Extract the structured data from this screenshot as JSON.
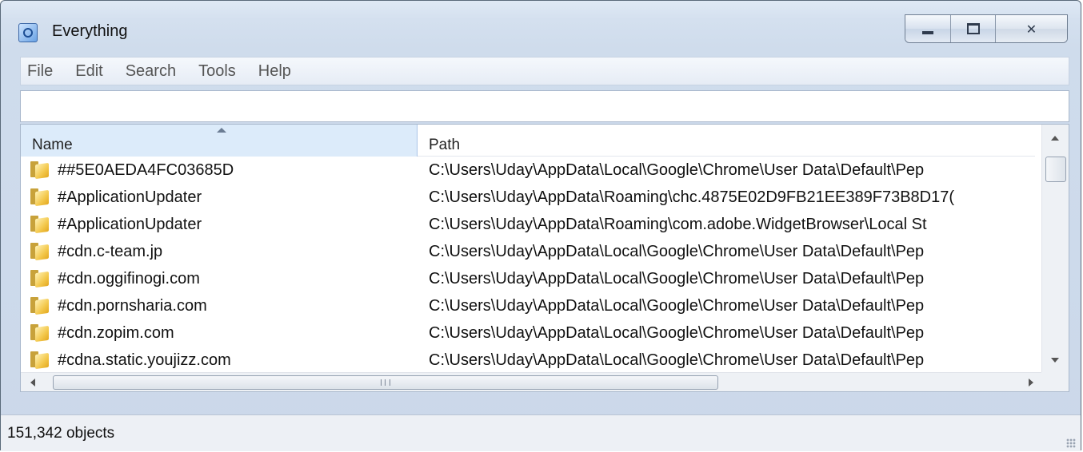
{
  "window": {
    "title": "Everything",
    "controls": {
      "minimize": "minimize",
      "maximize": "maximize",
      "close": "✕"
    }
  },
  "menu": [
    "File",
    "Edit",
    "Search",
    "Tools",
    "Help"
  ],
  "search": {
    "value": ""
  },
  "columns": {
    "name": "Name",
    "path": "Path"
  },
  "rows": [
    {
      "name": "##5E0AEDA4FC03685D",
      "path": "C:\\Users\\Uday\\AppData\\Local\\Google\\Chrome\\User Data\\Default\\Pep"
    },
    {
      "name": "#ApplicationUpdater",
      "path": "C:\\Users\\Uday\\AppData\\Roaming\\chc.4875E02D9FB21EE389F73B8D17("
    },
    {
      "name": "#ApplicationUpdater",
      "path": "C:\\Users\\Uday\\AppData\\Roaming\\com.adobe.WidgetBrowser\\Local St"
    },
    {
      "name": "#cdn.c-team.jp",
      "path": "C:\\Users\\Uday\\AppData\\Local\\Google\\Chrome\\User Data\\Default\\Pep"
    },
    {
      "name": "#cdn.oggifinogi.com",
      "path": "C:\\Users\\Uday\\AppData\\Local\\Google\\Chrome\\User Data\\Default\\Pep"
    },
    {
      "name": "#cdn.pornsharia.com",
      "path": "C:\\Users\\Uday\\AppData\\Local\\Google\\Chrome\\User Data\\Default\\Pep"
    },
    {
      "name": "#cdn.zopim.com",
      "path": "C:\\Users\\Uday\\AppData\\Local\\Google\\Chrome\\User Data\\Default\\Pep"
    },
    {
      "name": "#cdna.static.youjizz.com",
      "path": "C:\\Users\\Uday\\AppData\\Local\\Google\\Chrome\\User Data\\Default\\Pep"
    }
  ],
  "icons": {
    "row": "folder-icon",
    "app": "everything-app-icon"
  },
  "status": {
    "text": "151,342 objects"
  }
}
